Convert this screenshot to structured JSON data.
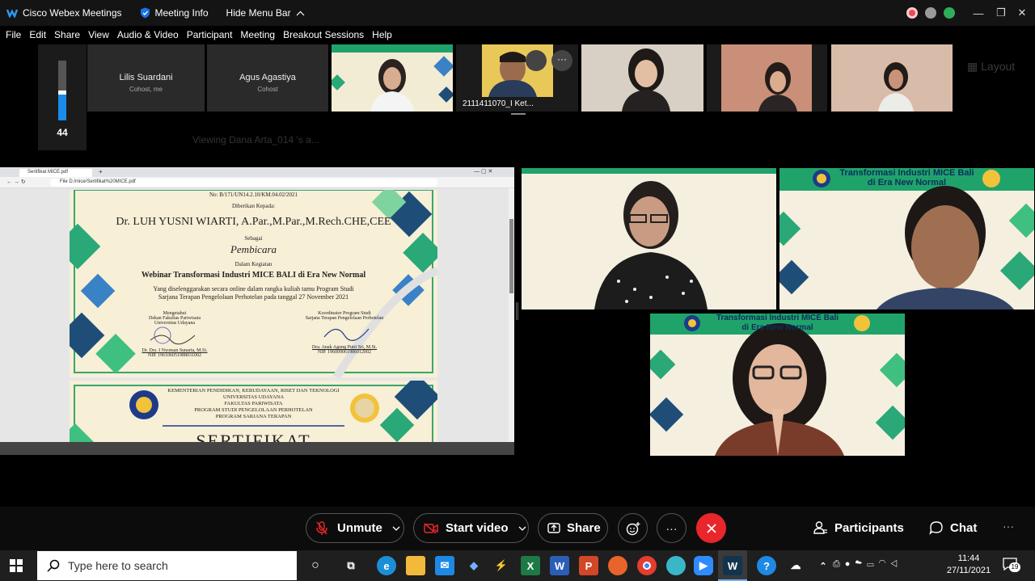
{
  "titlebar": {
    "app_name": "Cisco Webex Meetings",
    "meeting_info": "Meeting Info",
    "hide_menu": "Hide Menu Bar",
    "minimize": "—",
    "restore": "❐",
    "close": "✕"
  },
  "menu": [
    "File",
    "Edit",
    "Share",
    "View",
    "Audio & Video",
    "Participant",
    "Meeting",
    "Breakout Sessions",
    "Help"
  ],
  "volume": {
    "value": "44",
    "level": 0.44
  },
  "participants": [
    {
      "name": "Lilis Suardani",
      "role": "Cohost, me"
    },
    {
      "name": "Agus Agastiya",
      "role": "Cohost"
    }
  ],
  "filmstrip_label": "2111411070_I Ket...",
  "layout_label": "Layout",
  "viewing_label": "Viewing Dana Arta_014 's a...",
  "browser": {
    "tab_title": "Sertifikat MICE.pdf",
    "address": "File   D:/mice/Sertifikat%20MICE.pdf"
  },
  "certificate1": {
    "number": "No: B/171/UN14.2.10/KM.04.02/2021",
    "given_to": "Diberikan Kepada:",
    "recipient": "Dr. LUH YUSNI WIARTI, A.Par.,M.Par.,M.Rech.CHE,CEE",
    "as": "Sebagai",
    "role": "Pembicara",
    "in_activity": "Dalam Kegiatan",
    "event": "Webinar Transformasi Industri MICE BALI di Era New Normal",
    "desc1": "Yang diselenggarakan secara online dalam rangka kuliah tamu Program Studi",
    "desc2": "Sarjana Terapan Pengelolaan Perhotelan pada tanggal 27 November 2021",
    "left_title1": "Mengetahui",
    "left_title2": "Dekan Fakultas Pariwisata",
    "left_title3": "Universitas Udayana",
    "left_name": "Dr. Drs. I Nyoman Sunarta, M.Si.",
    "left_nip": "NIP. 196106051988031002",
    "right_title1": "Koordinator Program Studi",
    "right_title2": "Sarjana Terapan Pengelolaan Perhotelan",
    "right_name": "Dra. Anak Agung Putri Sri, M.Si.",
    "right_nip": "NIP. 196009061986012002"
  },
  "certificate2": {
    "line1": "KEMENTERIAN PENDIDIKAN, KEBUDAYAAN, RISET DAN TEKNOLOGI",
    "line2": "UNIVERSITAS UDAYANA",
    "line3": "FAKULTAS PARIWISATA",
    "line4": "PROGRAM STUDI PENGELOLAAN PERHOTELAN",
    "line5": "PROGRAM SARJANA TERAPAN",
    "title": "SERTIFIKAT"
  },
  "video_banner": {
    "line1": "Transformasi Industri MICE Bali",
    "line2": "di Era New Normal"
  },
  "toolbar": {
    "unmute": "Unmute",
    "start_video": "Start video",
    "share": "Share",
    "participants": "Participants",
    "chat": "Chat"
  },
  "taskbar": {
    "search_placeholder": "Type here to search",
    "time": "11:44",
    "date": "27/11/2021",
    "notifications": "19"
  },
  "colors": {
    "end_call": "#e8262b",
    "webex_blue": "#1a73e8",
    "banner_green": "#20a36b",
    "cert_cream": "#f7efd6"
  }
}
